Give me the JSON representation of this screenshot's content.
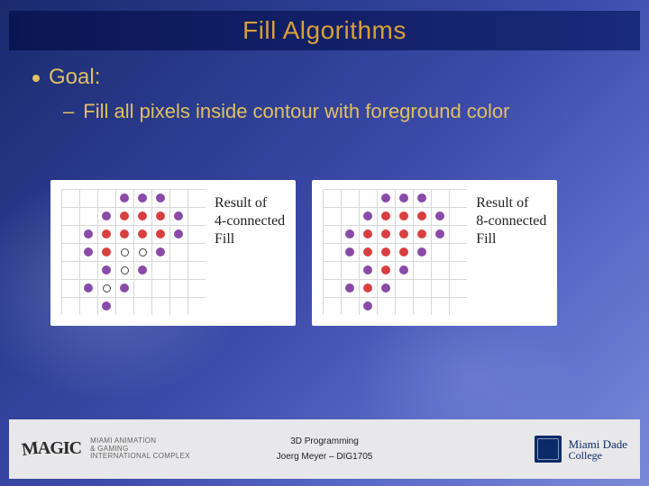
{
  "title": "Fill Algorithms",
  "bullets": {
    "b1": "Goal:",
    "b2": "Fill all pixels inside contour with foreground color"
  },
  "panels": [
    {
      "caption_l1": "Result of",
      "caption_l2": "4-connected",
      "caption_l3": "Fill"
    },
    {
      "caption_l1": "Result of",
      "caption_l2": "8-connected",
      "caption_l3": "Fill"
    }
  ],
  "footer": {
    "course": "3D Programming",
    "author": "Joerg Meyer – DIG1705",
    "left_logo": {
      "name": "MAGIC",
      "sub_l1": "MIAMI ANIMATION",
      "sub_l2": "& GAMING",
      "sub_l3": "INTERNATIONAL COMPLEX"
    },
    "right_logo": {
      "l1": "Miami Dade",
      "l2": "College"
    }
  },
  "chart_data": [
    {
      "type": "scatter",
      "title": "Result of 4-connected Fill",
      "grid": {
        "cols": 8,
        "rows": 7,
        "cell": 20
      },
      "contour": [
        [
          3,
          0
        ],
        [
          4,
          0
        ],
        [
          5,
          0
        ],
        [
          2,
          1
        ],
        [
          6,
          1
        ],
        [
          1,
          2
        ],
        [
          6,
          2
        ],
        [
          1,
          3
        ],
        [
          5,
          3
        ],
        [
          2,
          4
        ],
        [
          4,
          4
        ],
        [
          1,
          5
        ],
        [
          3,
          5
        ],
        [
          2,
          6
        ]
      ],
      "filled": [
        [
          3,
          1
        ],
        [
          4,
          1
        ],
        [
          5,
          1
        ],
        [
          2,
          2
        ],
        [
          3,
          2
        ],
        [
          4,
          2
        ],
        [
          5,
          2
        ],
        [
          2,
          3
        ]
      ],
      "holes": [
        [
          3,
          3
        ],
        [
          4,
          3
        ],
        [
          3,
          4
        ],
        [
          2,
          5
        ]
      ]
    },
    {
      "type": "scatter",
      "title": "Result of 8-connected Fill",
      "grid": {
        "cols": 8,
        "rows": 7,
        "cell": 20
      },
      "contour": [
        [
          3,
          0
        ],
        [
          4,
          0
        ],
        [
          5,
          0
        ],
        [
          2,
          1
        ],
        [
          6,
          1
        ],
        [
          1,
          2
        ],
        [
          6,
          2
        ],
        [
          1,
          3
        ],
        [
          5,
          3
        ],
        [
          2,
          4
        ],
        [
          4,
          4
        ],
        [
          1,
          5
        ],
        [
          3,
          5
        ],
        [
          2,
          6
        ]
      ],
      "filled": [
        [
          3,
          1
        ],
        [
          4,
          1
        ],
        [
          5,
          1
        ],
        [
          2,
          2
        ],
        [
          3,
          2
        ],
        [
          4,
          2
        ],
        [
          5,
          2
        ],
        [
          2,
          3
        ],
        [
          3,
          3
        ],
        [
          4,
          3
        ],
        [
          3,
          4
        ],
        [
          2,
          5
        ]
      ],
      "holes": []
    }
  ]
}
